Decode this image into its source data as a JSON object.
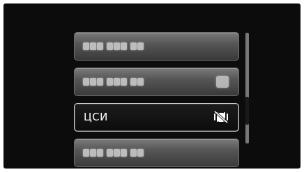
{
  "menu": {
    "items": [
      {
        "label": "",
        "blurred": true,
        "has_value": false
      },
      {
        "label": "",
        "blurred": true,
        "has_value": true
      },
      {
        "label": "ЦСИ",
        "blurred": false,
        "selected": true,
        "icon": "image-stabilizer-off-icon"
      },
      {
        "label": "",
        "blurred": true,
        "has_value": false
      }
    ]
  },
  "colors": {
    "background": "#0c0c0c",
    "item_gradient_top": "#7a7a7a",
    "item_gradient_bottom": "#3a3a3a",
    "selected_border": "#d8d8d8",
    "text": "#ffffff"
  },
  "scrollbar": {
    "position_fraction": 0.58
  }
}
